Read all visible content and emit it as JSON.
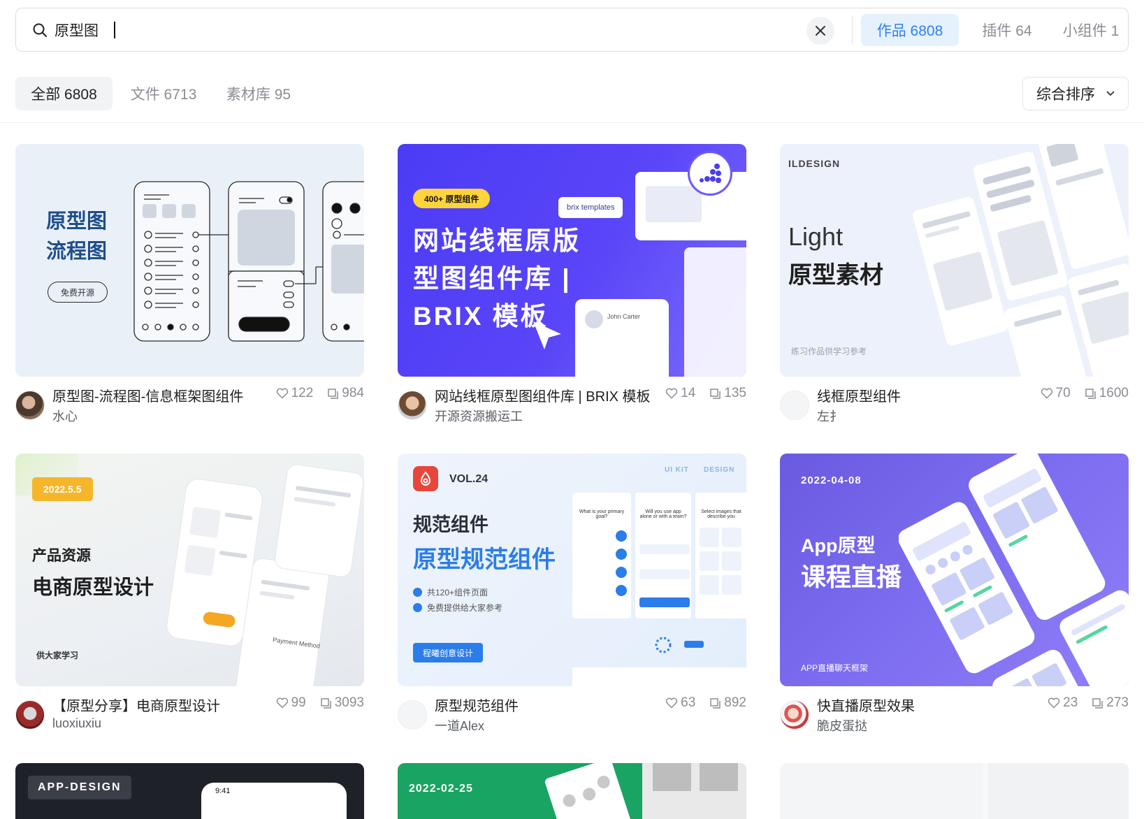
{
  "search": {
    "value": "原型图",
    "placeholder": ""
  },
  "scope_tabs": [
    {
      "label": "作品 6808",
      "active": true
    },
    {
      "label": "插件 64",
      "active": false
    },
    {
      "label": "小组件 1",
      "active": false
    }
  ],
  "filter_tabs": [
    {
      "label": "全部 6808",
      "active": true
    },
    {
      "label": "文件 6713",
      "active": false
    },
    {
      "label": "素材库 95",
      "active": false
    }
  ],
  "sort": {
    "label": "综合排序"
  },
  "cards": [
    {
      "title": "原型图-流程图-信息框架图组件",
      "author": "水心",
      "likes": "122",
      "copies": "984",
      "thumb": {
        "line1": "原型图",
        "line2": "流程图",
        "button": "免费开源"
      }
    },
    {
      "title": "网站线框原型图组件库 | BRIX 模板",
      "author": "开源资源搬运工",
      "likes": "14",
      "copies": "135",
      "thumb": {
        "badge": "400+ 原型组件",
        "line1": "网站线框原版",
        "line2": "型图组件库 |",
        "line3": "BRIX 模板",
        "brand": "brix templates",
        "name": "John Carter"
      }
    },
    {
      "title": "线框原型组件",
      "author": "左扌",
      "likes": "70",
      "copies": "1600",
      "thumb": {
        "brand": "ILDESIGN",
        "line1": "Light",
        "line2": "原型素材",
        "caption": "练习作品供学习参考"
      }
    },
    {
      "title": "【原型分享】电商原型设计",
      "author": "luoxiuxiu",
      "likes": "99",
      "copies": "3093",
      "thumb": {
        "date": "2022.5.5",
        "line1": "产品资源",
        "line2": "电商原型设计",
        "caption": "供大家学习",
        "card_label": "Payment Method"
      }
    },
    {
      "title": "原型规范组件",
      "author": "一道Alex",
      "likes": "63",
      "copies": "892",
      "thumb": {
        "vol": "VOL.24",
        "kit1": "UI KIT",
        "kit2": "DESIGN",
        "line1": "规范组件",
        "line2": "原型规范组件",
        "bullet1": "共120+组件页面",
        "bullet2": "免费提供给大家参考",
        "button": "程曦创意设计",
        "screen1": "What is your primary goal?",
        "screen2": "Will you use app alone or with a team?",
        "screen3": "Select images that describe you"
      }
    },
    {
      "title": "快直播原型效果",
      "author": "脆皮蛋挞",
      "likes": "23",
      "copies": "273",
      "thumb": {
        "date": "2022-04-08",
        "line1": "App原型",
        "line2": "课程直播",
        "caption": "APP直播聊天框架"
      }
    },
    {
      "title": "",
      "author": "",
      "likes": "",
      "copies": "",
      "thumb": {
        "label": "APP-DESIGN",
        "time": "9:41"
      }
    },
    {
      "title": "",
      "author": "",
      "likes": "",
      "copies": "",
      "thumb": {
        "date": "2022-02-25"
      }
    },
    {
      "title": "",
      "author": "",
      "likes": "",
      "copies": "",
      "thumb": {}
    }
  ],
  "colors": {
    "accent": "#2d7ff9",
    "accent_bg": "#e6f1fe",
    "muted": "#8a8d93",
    "border": "#d9dce1"
  },
  "icons": {
    "search": "search-icon",
    "clear": "close-icon",
    "sort": "chevron-down-icon",
    "like": "heart-icon",
    "copy": "duplicate-icon"
  }
}
